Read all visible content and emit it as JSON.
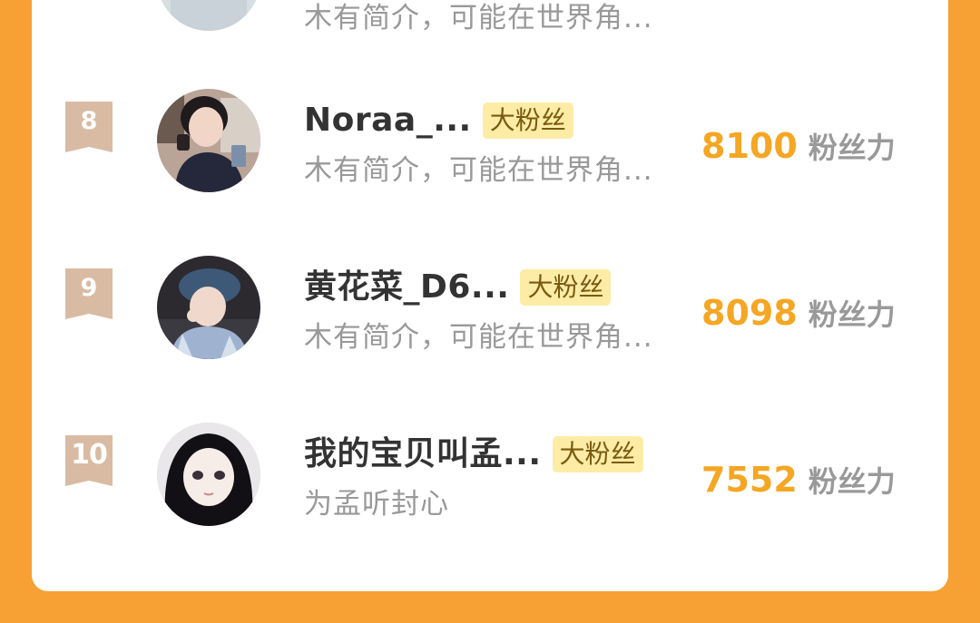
{
  "ranking": {
    "partial_top_row": {
      "bio": "木有简介，可能在世界角..."
    },
    "rows": [
      {
        "rank": "8",
        "name": "Noraa_...",
        "badge": "大粉丝",
        "bio": "木有简介，可能在世界角...",
        "score": "8100",
        "score_unit": "粉丝力"
      },
      {
        "rank": "9",
        "name": "黄花菜_D6...",
        "badge": "大粉丝",
        "bio": "木有简介，可能在世界角...",
        "score": "8098",
        "score_unit": "粉丝力"
      },
      {
        "rank": "10",
        "name": "我的宝贝叫孟...",
        "badge": "大粉丝",
        "bio": "为孟听封心",
        "score": "7552",
        "score_unit": "粉丝力"
      }
    ]
  },
  "colors": {
    "background": "#F7A033",
    "score": "#F5A623",
    "badge_bg": "#FDECA6",
    "rank_ribbon": "#D9BBA3"
  },
  "icons": {
    "rank_ribbon": "bookmark-ribbon-icon"
  }
}
